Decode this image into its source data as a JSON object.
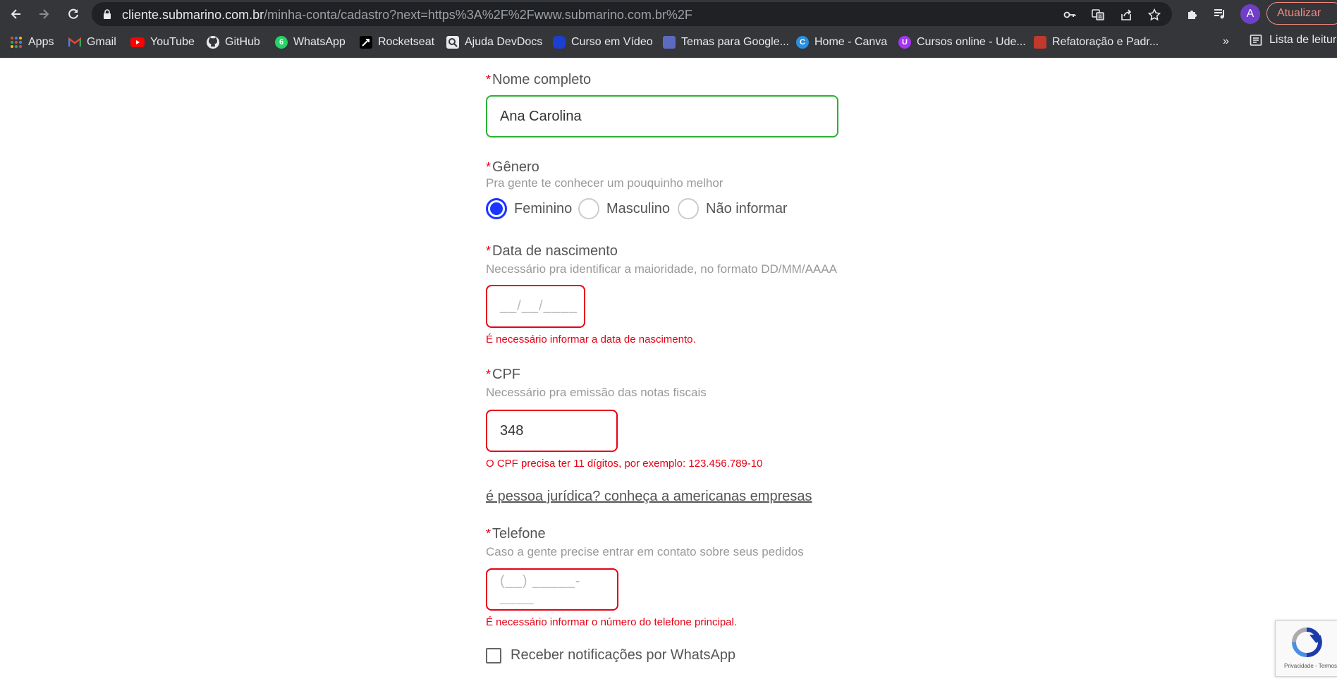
{
  "browser": {
    "url_host": "cliente.submarino.com.br",
    "url_path": "/minha-conta/cadastro?next=https%3A%2F%2Fwww.submarino.com.br%2F",
    "avatar_letter": "A",
    "update_label": "Atualizar",
    "more_bookmarks": "»",
    "reading_list_label": "Lista de leitura",
    "bookmarks": [
      {
        "label": "Apps",
        "icon": "apps-grid-icon"
      },
      {
        "label": "Gmail",
        "icon": "gmail-icon"
      },
      {
        "label": "YouTube",
        "icon": "youtube-icon"
      },
      {
        "label": "GitHub",
        "icon": "github-icon"
      },
      {
        "label": "WhatsApp",
        "icon": "whatsapp-icon"
      },
      {
        "label": "Rocketseat",
        "icon": "rocketseat-icon"
      },
      {
        "label": "Ajuda DevDocs",
        "icon": "devdocs-icon"
      },
      {
        "label": "Curso em Vídeo",
        "icon": "cursoemvideo-icon"
      },
      {
        "label": "Temas para Google...",
        "icon": "themes-icon"
      },
      {
        "label": "Home - Canva",
        "icon": "canva-icon"
      },
      {
        "label": "Cursos online - Ude...",
        "icon": "udemy-icon"
      },
      {
        "label": "Refatoração e Padr...",
        "icon": "refactoring-icon"
      }
    ]
  },
  "form": {
    "required_mark": "*",
    "name": {
      "label": "Nome completo",
      "value": "Ana Carolina"
    },
    "gender": {
      "label": "Gênero",
      "hint": "Pra gente te conhecer um pouquinho melhor",
      "options": [
        "Feminino",
        "Masculino",
        "Não informar"
      ],
      "selected": "Feminino"
    },
    "birthdate": {
      "label": "Data de nascimento",
      "hint": "Necessário pra identificar a maioridade, no formato DD/MM/AAAA",
      "placeholder": "__/__/____",
      "error": "É necessário informar a data de nascimento."
    },
    "cpf": {
      "label": "CPF",
      "hint": "Necessário pra emissão das notas fiscais",
      "value": "348",
      "error": "O CPF precisa ter 11 dígitos, por exemplo: 123.456.789-10"
    },
    "company_link": "é pessoa jurídica? conheça a americanas empresas",
    "phone": {
      "label": "Telefone",
      "hint": "Caso a gente precise entrar em contato sobre seus pedidos",
      "placeholder": "(__) _____-____",
      "error": "É necessário informar o número do telefone principal."
    },
    "whatsapp_opt_in": {
      "label": "Receber notificações por WhatsApp",
      "checked": false
    }
  },
  "recaptcha": {
    "terms": "Privacidade - Termos"
  },
  "colors": {
    "required": "#e60014",
    "valid_border": "#2bb033",
    "radio_selected": "#1a36ff",
    "chrome_bg": "#35363a"
  }
}
